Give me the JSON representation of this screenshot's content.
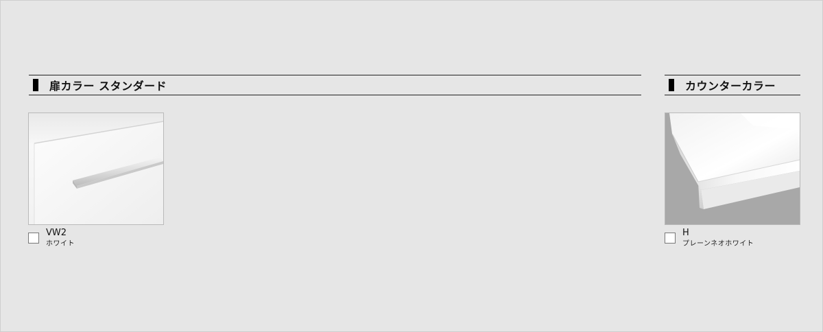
{
  "sections": {
    "door_color": {
      "title": "扉カラー スタンダード",
      "options": [
        {
          "code": "VW2",
          "name": "ホワイト",
          "checked": false
        }
      ]
    },
    "counter_color": {
      "title": "カウンターカラー",
      "options": [
        {
          "code": "H",
          "name": "プレーンネオホワイト",
          "checked": false
        }
      ]
    }
  },
  "colors": {
    "background": "#e6e6e6",
    "header_rule": "#222222",
    "marker": "#000000"
  }
}
